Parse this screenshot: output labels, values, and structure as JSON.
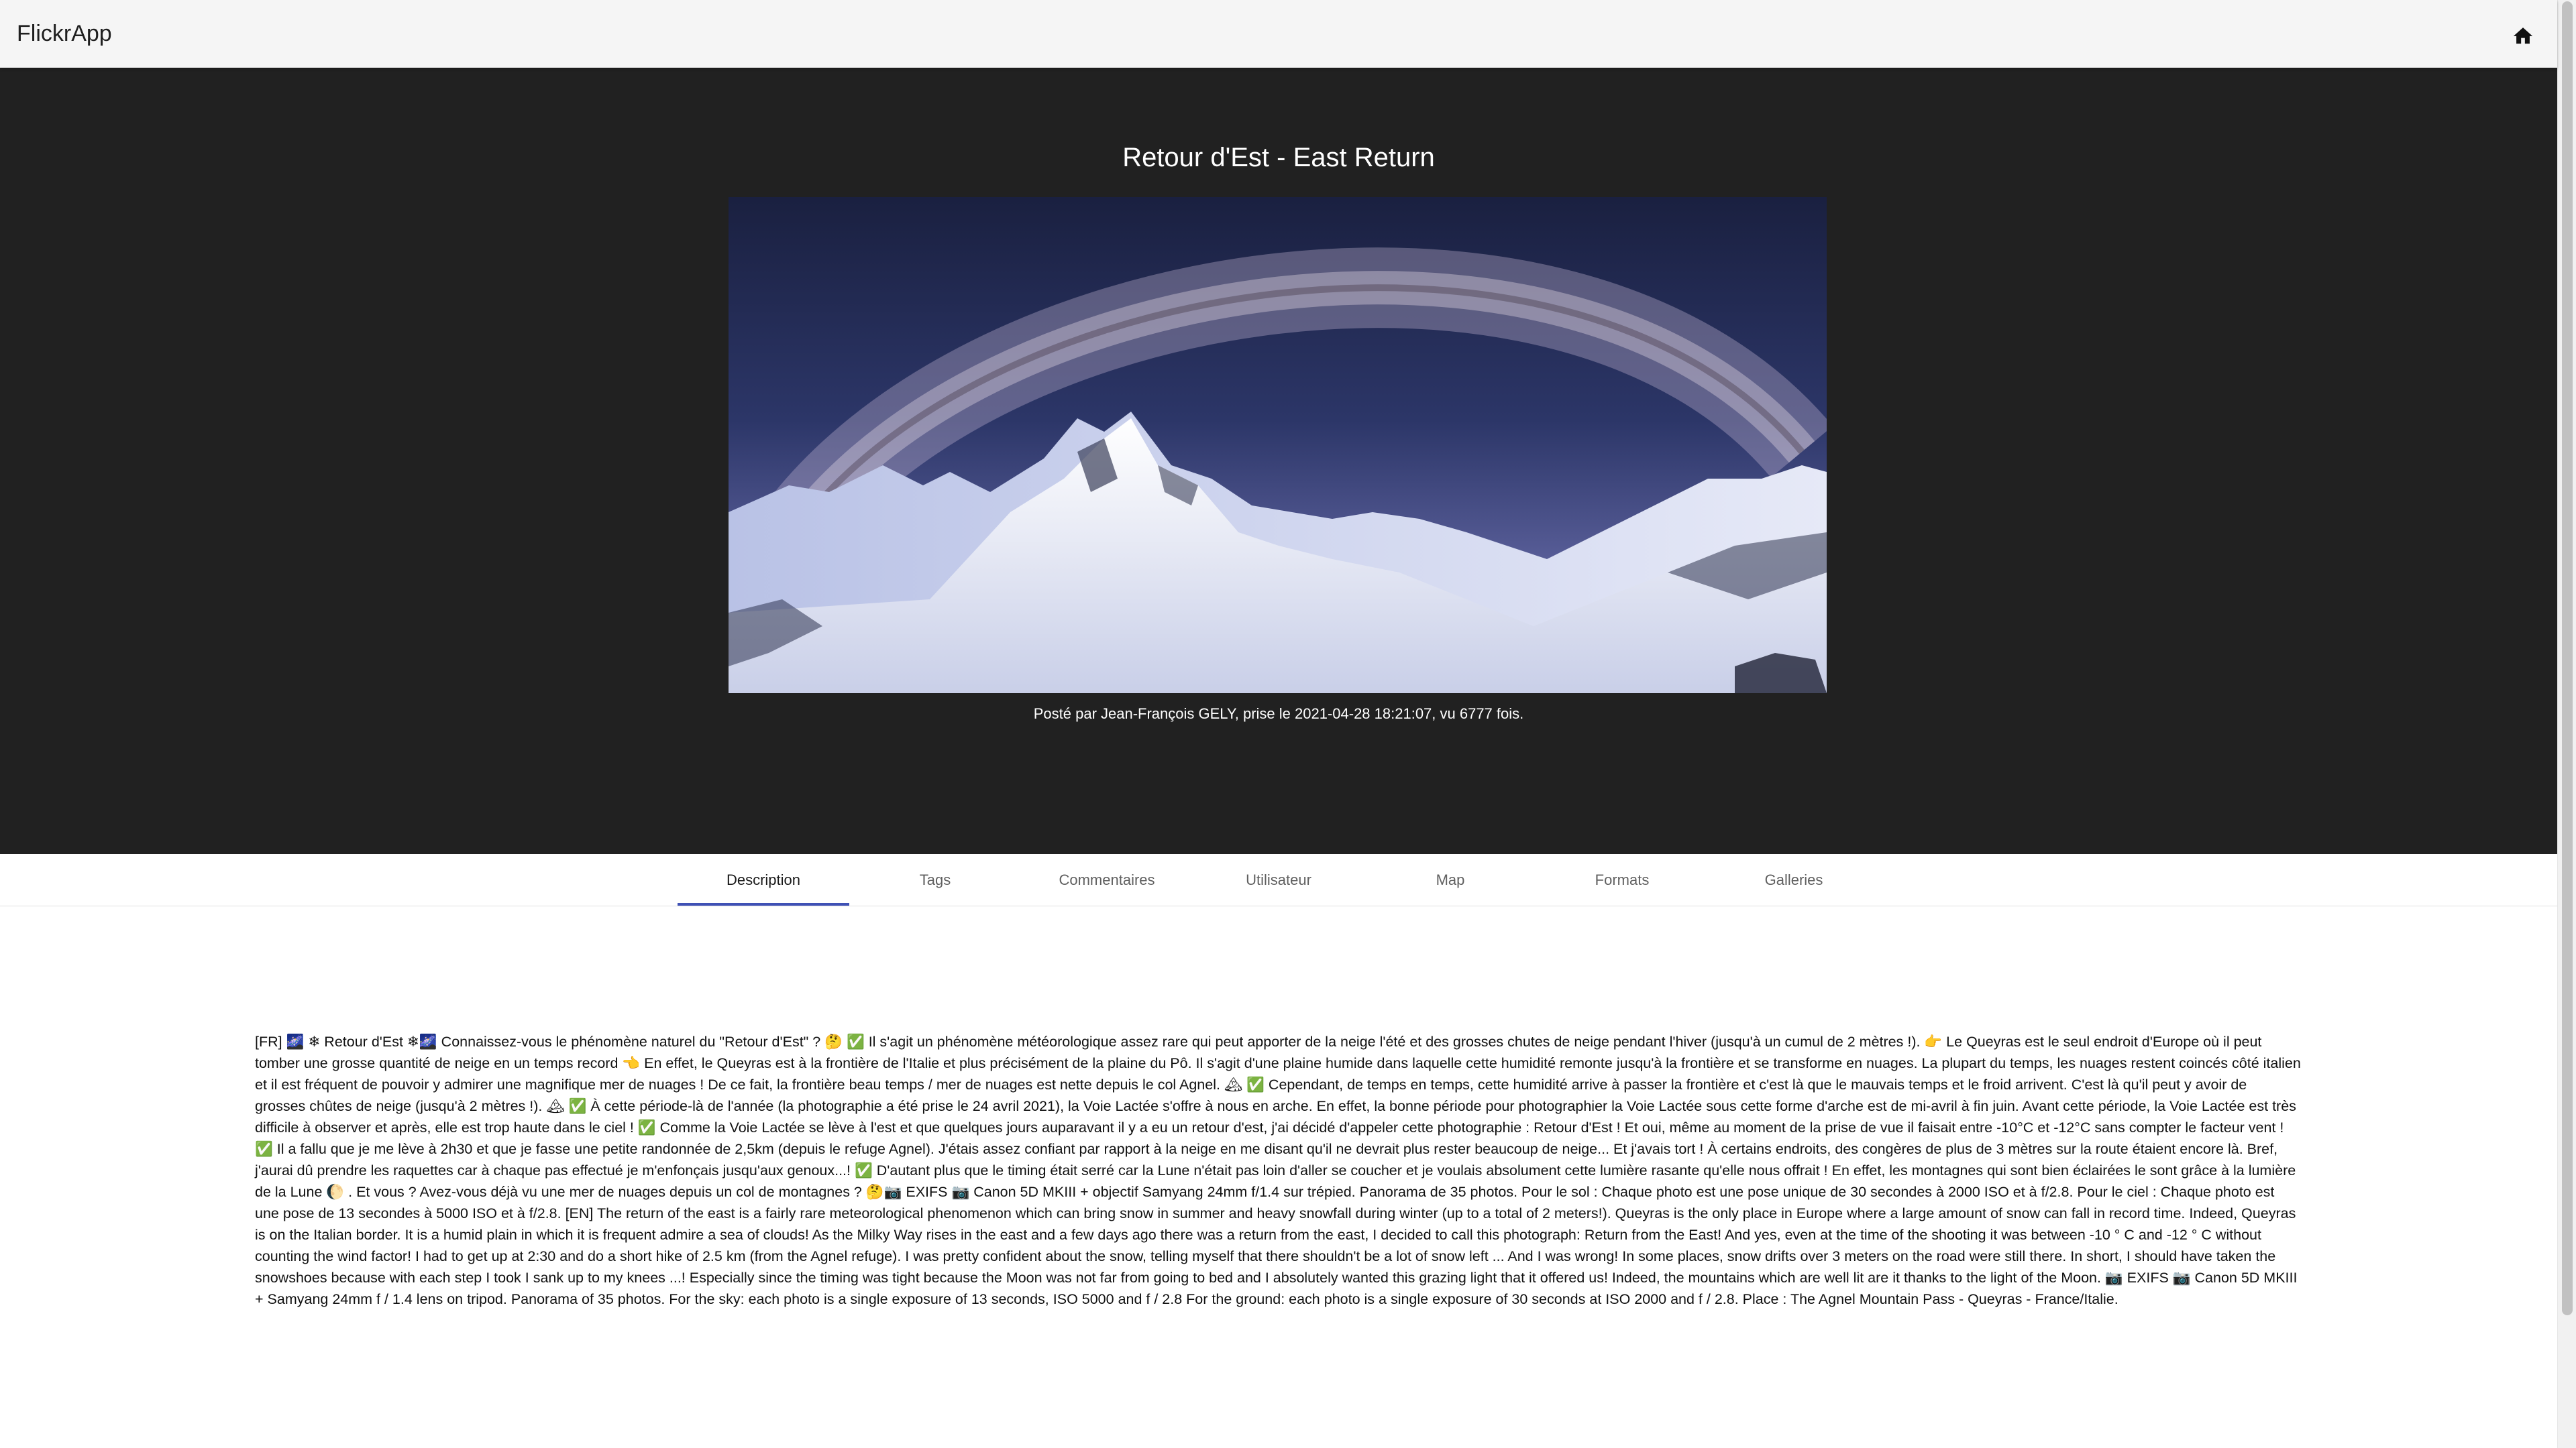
{
  "app": {
    "title": "FlickrApp",
    "home_icon": "home-icon"
  },
  "photo": {
    "title": "Retour d'Est - East Return",
    "caption": "Posté par Jean-François GELY, prise le 2021-04-28 18:21:07, vu 6777 fois."
  },
  "tabs": [
    {
      "label": "Description",
      "active": true
    },
    {
      "label": "Tags",
      "active": false
    },
    {
      "label": "Commentaires",
      "active": false
    },
    {
      "label": "Utilisateur",
      "active": false
    },
    {
      "label": "Map",
      "active": false
    },
    {
      "label": "Formats",
      "active": false
    },
    {
      "label": "Galleries",
      "active": false
    }
  ],
  "description": "[FR] 🌌 ❄ Retour d'Est ❄🌌  Connaissez-vous le phénomène naturel du \"Retour d'Est\" ? 🤔 ✅  Il s'agit un phénomène météorologique assez rare qui peut apporter de la neige l'été et des grosses chutes de neige pendant l'hiver (jusqu'à un cumul de 2 mètres !). 👉  Le Queyras est le seul endroit d'Europe où il peut tomber une grosse quantité de neige en un temps record 👈  En effet, le Queyras est à la frontière de l'Italie et plus précisément de la plaine du Pô. Il s'agit d'une plaine humide dans laquelle cette humidité remonte jusqu'à la frontière et se transforme en nuages. La plupart du temps, les nuages restent coincés côté italien et il est fréquent de pouvoir y admirer une magnifique mer de nuages ! De ce fait, la frontière beau temps / mer de nuages est nette depuis le col Agnel. 🏔  ✅  Cependant, de temps en temps, cette humidité arrive à passer la frontière et c'est là que le mauvais temps et le froid arrivent. C'est là qu'il peut y avoir de grosses chûtes de neige (jusqu'à 2 mètres !). 🏔  ✅  À cette période-là de l'année (la photographie a été prise le 24 avril 2021), la Voie Lactée s'offre à nous en arche. En effet, la bonne période pour photographier la Voie Lactée sous cette forme d'arche est de mi-avril à fin juin. Avant cette période, la Voie Lactée est très difficile à observer et après, elle est trop haute dans le ciel ! ✅  Comme la Voie Lactée se lève à l'est et que quelques jours auparavant il y a eu un retour d'est, j'ai décidé d'appeler cette photographie : Retour d'Est ! Et oui, même au moment de la prise de vue il faisait entre -10°C et -12°C sans compter le facteur vent ! ✅  Il a fallu que je me lève à 2h30 et que je fasse une petite randonnée de 2,5km (depuis le refuge Agnel). J'étais assez confiant par rapport à la neige en me disant qu'il ne devrait plus rester beaucoup de neige... Et j'avais tort ! À certains endroits, des congères de plus de 3 mètres sur la route étaient encore là. Bref, j'aurai dû prendre les raquettes car à chaque pas effectué je m'enfonçais jusqu'aux genoux...! ✅  D'autant plus que le timing était serré car la Lune n'était pas loin d'aller se coucher et je voulais absolument cette lumière rasante qu'elle nous offrait ! En effet, les montagnes qui sont bien éclairées le sont grâce à la lumière de la Lune 🌔 . Et vous ? Avez-vous déjà vu une mer de nuages depuis un col de montagnes ? 🤔📷  EXIFS 📷  Canon 5D MKIII + objectif Samyang 24mm f/1.4 sur trépied. Panorama de 35 photos. Pour le sol : Chaque photo est une pose unique de 30 secondes à 2000 ISO et à f/2.8. Pour le ciel : Chaque photo est une pose de 13 secondes à 5000 ISO et à f/2.8. [EN] The return of the east is a fairly rare meteorological phenomenon which can bring snow in summer and heavy snowfall during winter (up to a total of 2 meters!). Queyras is the only place in Europe where a large amount of snow can fall in record time. Indeed, Queyras is on the Italian border. It is a humid plain in which it is frequent admire a sea of clouds! As the Milky Way rises in the east and a few days ago there was a return from the east, I decided to call this photograph: Return from the East! And yes, even at the time of the shooting it was between -10 ° C and -12 ° C without counting the wind factor! I had to get up at 2:30 and do a short hike of 2.5 km (from the Agnel refuge). I was pretty confident about the snow, telling myself that there shouldn't be a lot of snow left ... And I was wrong! In some places, snow drifts over 3 meters on the road were still there. In short, I should have taken the snowshoes because with each step I took I sank up to my knees ...! Especially since the timing was tight because the Moon was not far from going to bed and I absolutely wanted this grazing light that it offered us! Indeed, the mountains which are well lit are it thanks to the light of the Moon. 📷  EXIFS 📷  Canon 5D MKIII + Samyang 24mm f / 1.4 lens on tripod. Panorama of 35 photos. For the sky: each photo is a single exposure of 13 seconds, ISO 5000 and f / 2.8 For the ground: each photo is a single exposure of 30 seconds at ISO 2000 and f / 2.8. Place : The Agnel Mountain Pass - Queyras - France/Italie."
}
